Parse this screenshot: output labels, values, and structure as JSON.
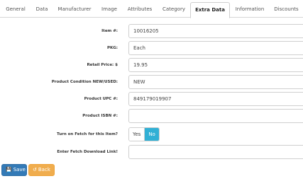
{
  "tabs": [
    {
      "label": "General"
    },
    {
      "label": "Data"
    },
    {
      "label": "Manufacturer"
    },
    {
      "label": "Image"
    },
    {
      "label": "Attributes"
    },
    {
      "label": "Category"
    },
    {
      "label": "Extra Data",
      "active": true
    },
    {
      "label": "Information"
    },
    {
      "label": "Discounts"
    }
  ],
  "form": {
    "item": {
      "label": "Item #:",
      "value": "10016205"
    },
    "pkg": {
      "label": "PKG:",
      "value": "Each"
    },
    "retail_price": {
      "label": "Retail Price: $",
      "value": "19.95"
    },
    "condition": {
      "label": "Product Condition NEW/USED:",
      "value": "NEW"
    },
    "upc": {
      "label": "Product UPC #:",
      "value": "849179019907"
    },
    "isbn": {
      "label": "Product ISBN #:",
      "value": ""
    },
    "fetch": {
      "label": "Turn on Fetch for this Item?",
      "yes": "Yes",
      "no": "No",
      "selected": "No"
    },
    "fetch_link": {
      "label": "Enter Fetch Download Link!",
      "value": ""
    }
  },
  "actions": {
    "save_label": "Save",
    "save_icon": "floppy-disk-icon",
    "back_label": "Back",
    "back_icon": "undo-icon"
  },
  "colors": {
    "primary": "#337ab7",
    "warning": "#f0ad4e",
    "toggle_on": "#31b0d5"
  }
}
